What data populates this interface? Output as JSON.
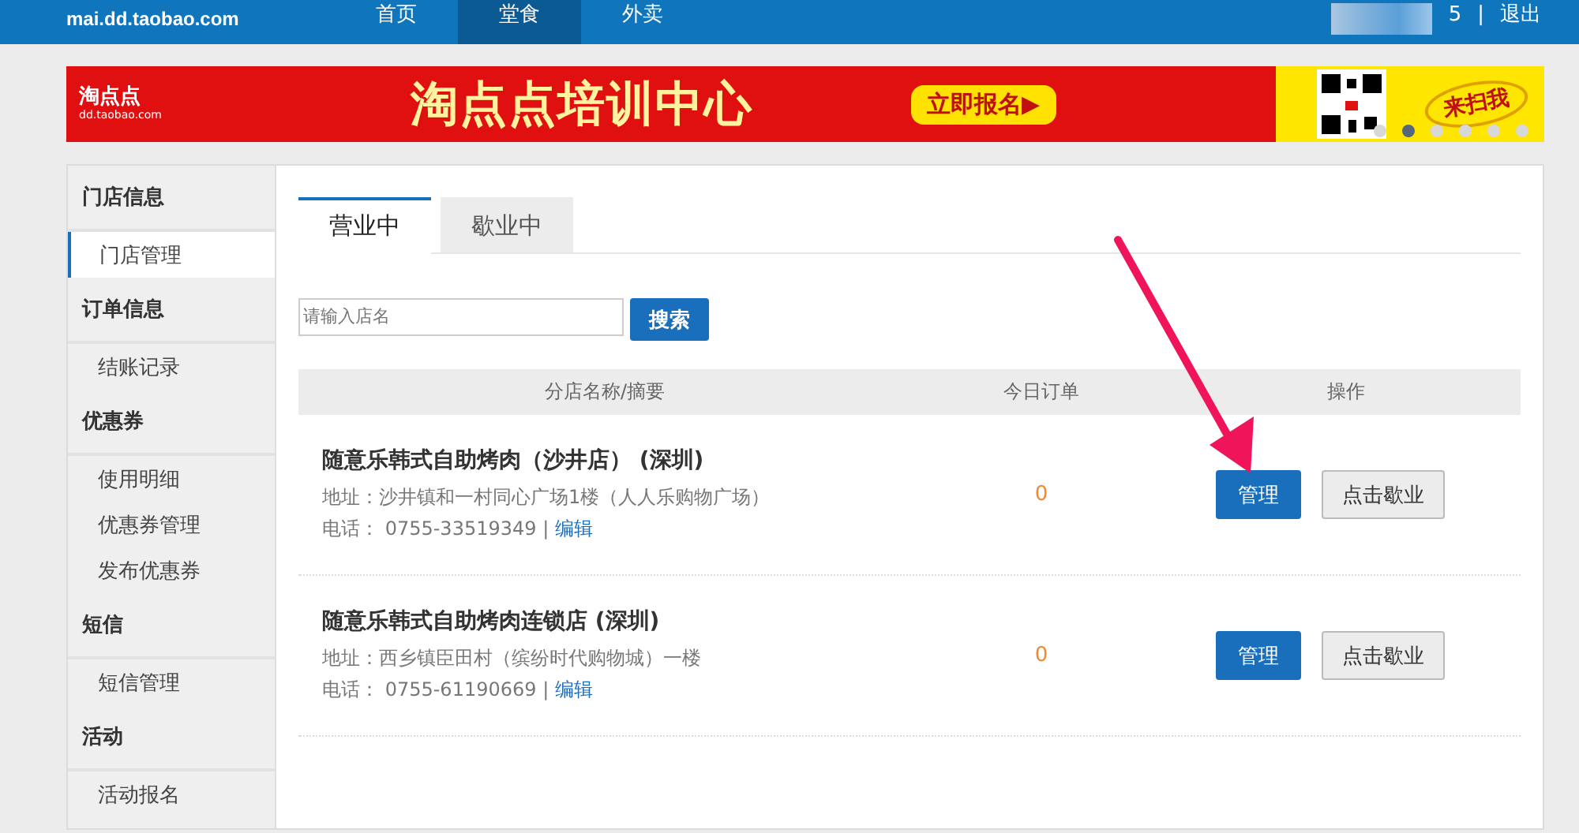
{
  "header": {
    "logo_domain": "mai.dd.taobao.com",
    "nav": [
      {
        "label": "首页",
        "selected": false
      },
      {
        "label": "堂食",
        "selected": true
      },
      {
        "label": "外卖",
        "selected": false
      }
    ],
    "user_suffix": "5",
    "separator": "|",
    "logout": "退出"
  },
  "banner": {
    "brand": "淘点点",
    "brand_domain": "dd.taobao.com",
    "headline": "淘点点培训中心",
    "cta": "立即报名",
    "cta_arrow": "▶",
    "scan": "来扫我",
    "dots": [
      {
        "selected": false
      },
      {
        "selected": true
      },
      {
        "selected": false
      },
      {
        "selected": false
      },
      {
        "selected": false
      },
      {
        "selected": false
      }
    ]
  },
  "sidebar": [
    {
      "title": "门店信息",
      "items": [
        {
          "label": "门店管理",
          "selected": true
        }
      ]
    },
    {
      "title": "订单信息",
      "items": [
        {
          "label": "结账记录",
          "selected": false
        }
      ]
    },
    {
      "title": "优惠券",
      "items": [
        {
          "label": "使用明细",
          "selected": false
        },
        {
          "label": "优惠券管理",
          "selected": false
        },
        {
          "label": "发布优惠券",
          "selected": false
        }
      ]
    },
    {
      "title": "短信",
      "items": [
        {
          "label": "短信管理",
          "selected": false
        }
      ]
    },
    {
      "title": "活动",
      "items": [
        {
          "label": "活动报名",
          "selected": false
        }
      ]
    }
  ],
  "tabs": [
    {
      "label": "营业中",
      "selected": true
    },
    {
      "label": "歇业中",
      "selected": false
    }
  ],
  "search": {
    "placeholder": "请输入店名",
    "button": "搜索"
  },
  "table": {
    "columns": [
      "分店名称/摘要",
      "今日订单",
      "操作"
    ],
    "rows": [
      {
        "name": "随意乐韩式自助烤肉（沙井店） (深圳)",
        "address": "地址：沙井镇和一村同心广场1楼（人人乐购物广场）",
        "phone": "电话： 0755-33519349 |",
        "edit": "编辑",
        "orders": "0",
        "actions": [
          "管理",
          "点击歇业"
        ]
      },
      {
        "name": "随意乐韩式自助烤肉连锁店 (深圳)",
        "address": "地址：西乡镇臣田村（缤纷时代购物城）一楼",
        "phone": "电话： 0755-61190669 |",
        "edit": "编辑",
        "orders": "0",
        "actions": [
          "管理",
          "点击歇业"
        ]
      }
    ]
  },
  "annotation": {
    "kind": "arrow"
  }
}
